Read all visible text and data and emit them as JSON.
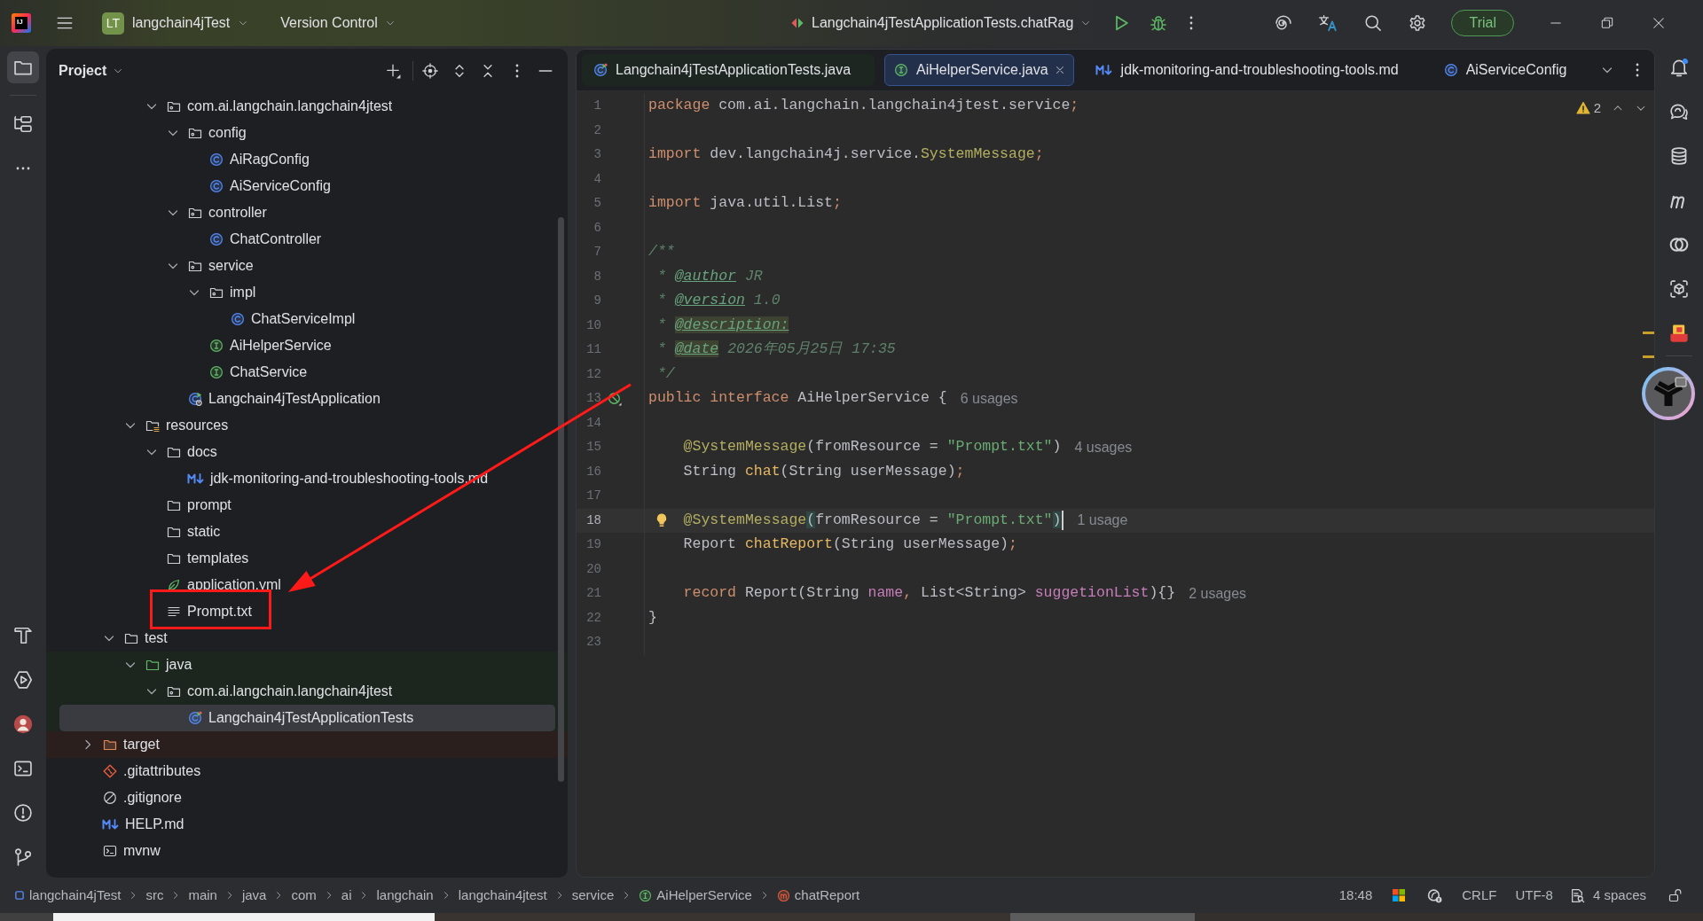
{
  "title_bar": {
    "logo": "IJ",
    "project_badge": "LT",
    "project": "langchain4jTest",
    "vcs": "Version Control",
    "run_config": "Langchain4jTestApplicationTests.chatRag",
    "trial": "Trial"
  },
  "left_tools": {
    "top": [
      {
        "selected": true
      },
      {
        "selected": false
      }
    ],
    "bottom": [
      {
        "selected": false
      },
      {
        "selected": false
      },
      {
        "selected": false
      },
      {
        "selected": false
      },
      {
        "selected": false
      },
      {
        "selected": false
      }
    ]
  },
  "project_panel": {
    "title": "Project",
    "tree": [
      {
        "children": [
          {
            "children": [
              {
                "children": [
                  {
                    "children": [
                      {
                        "label": "com.ai.langchain.langchain4jtest",
                        "kind": "package",
                        "expanded": true,
                        "selected": false,
                        "boxed": false,
                        "children": [
                          {
                            "label": "config",
                            "kind": "package",
                            "expanded": true,
                            "selected": false,
                            "boxed": false,
                            "children": [
                              {
                                "label": "AiRagConfig",
                                "kind": "class",
                                "selected": false,
                                "boxed": false
                              },
                              {
                                "label": "AiServiceConfig",
                                "kind": "class",
                                "selected": false,
                                "boxed": false
                              }
                            ]
                          },
                          {
                            "label": "controller",
                            "kind": "package",
                            "expanded": true,
                            "selected": false,
                            "boxed": false,
                            "children": [
                              {
                                "label": "ChatController",
                                "kind": "class",
                                "selected": false,
                                "boxed": false
                              }
                            ]
                          },
                          {
                            "label": "service",
                            "kind": "package",
                            "expanded": true,
                            "selected": false,
                            "boxed": false,
                            "children": [
                              {
                                "label": "impl",
                                "kind": "package",
                                "expanded": true,
                                "selected": false,
                                "boxed": false,
                                "children": [
                                  {
                                    "label": "ChatServiceImpl",
                                    "kind": "class",
                                    "selected": false,
                                    "boxed": false
                                  }
                                ]
                              },
                              {
                                "label": "AiHelperService",
                                "kind": "interface",
                                "selected": false,
                                "boxed": false
                              },
                              {
                                "label": "ChatService",
                                "kind": "interface",
                                "selected": false,
                                "boxed": false
                              }
                            ]
                          },
                          {
                            "label": "Langchain4jTestApplication",
                            "kind": "app_class",
                            "selected": false,
                            "boxed": false
                          }
                        ]
                      }
                    ]
                  },
                  {
                    "label": "resources",
                    "kind": "resource_root",
                    "expanded": true,
                    "selected": false,
                    "boxed": false,
                    "children": [
                      {
                        "label": "docs",
                        "kind": "folder",
                        "expanded": true,
                        "selected": false,
                        "boxed": false,
                        "children": [
                          {
                            "label": "jdk-monitoring-and-troubleshooting-tools.md",
                            "kind": "markdown",
                            "selected": false,
                            "boxed": false
                          }
                        ]
                      },
                      {
                        "label": "prompt",
                        "kind": "folder",
                        "selected": false,
                        "boxed": false
                      },
                      {
                        "label": "static",
                        "kind": "folder",
                        "selected": false,
                        "boxed": false
                      },
                      {
                        "label": "templates",
                        "kind": "folder",
                        "selected": false,
                        "boxed": false
                      },
                      {
                        "label": "application.yml",
                        "kind": "yaml",
                        "selected": false,
                        "boxed": false
                      },
                      {
                        "label": "Prompt.txt",
                        "kind": "text",
                        "selected": false,
                        "boxed": true
                      }
                    ]
                  }
                ]
              },
              {
                "label": "test",
                "kind": "folder",
                "expanded": true,
                "selected": false,
                "boxed": false,
                "children": [
                  {
                    "label": "java",
                    "kind": "test_root",
                    "expanded": true,
                    "selected": false,
                    "boxed": false,
                    "children": [
                      {
                        "label": "com.ai.langchain.langchain4jtest",
                        "kind": "package",
                        "expanded": true,
                        "selected": false,
                        "boxed": false,
                        "children": [
                          {
                            "label": "Langchain4jTestApplicationTests",
                            "kind": "test_class",
                            "selected": true,
                            "boxed": false
                          }
                        ]
                      }
                    ]
                  }
                ]
              }
            ]
          },
          {
            "label": "target",
            "kind": "excluded",
            "expanded": false,
            "selected": false,
            "boxed": false
          },
          {
            "label": ".gitattributes",
            "kind": "gitattributes",
            "selected": false,
            "boxed": false
          },
          {
            "label": ".gitignore",
            "kind": "gitignore",
            "selected": false,
            "boxed": false
          },
          {
            "label": "HELP.md",
            "kind": "markdown",
            "selected": false,
            "boxed": false
          },
          {
            "label": "mvnw",
            "kind": "script",
            "selected": false,
            "boxed": false
          }
        ]
      }
    ]
  },
  "annotation": {
    "kind": "arrow"
  },
  "editor": {
    "tabs": [
      {
        "label": "Langchain4jTestApplicationTests.java",
        "kind": "test_class",
        "selected": false
      },
      {
        "label": "AiHelperService.java",
        "kind": "interface",
        "selected": true
      },
      {
        "label": "jdk-monitoring-and-troubleshooting-tools.md",
        "kind": "markdown",
        "selected": false
      },
      {
        "label": "AiServiceConfig",
        "kind": "class",
        "selected": false
      }
    ],
    "warnings": "2",
    "lines": [
      {
        "number": "1",
        "current": false,
        "tokens": [
          {
            "text": "package",
            "kind": "keyword"
          },
          {
            "text": " com.ai.langchain.langchain4jtest.service",
            "kind": "plain"
          },
          {
            "text": ";",
            "kind": "punct"
          }
        ]
      },
      {
        "number": "2",
        "current": false
      },
      {
        "number": "3",
        "current": false,
        "tokens": [
          {
            "text": "import",
            "kind": "keyword"
          },
          {
            "text": " dev.langchain4j.service.",
            "kind": "plain"
          },
          {
            "text": "SystemMessage",
            "kind": "annotation"
          },
          {
            "text": ";",
            "kind": "punct"
          }
        ]
      },
      {
        "number": "4",
        "current": false
      },
      {
        "number": "5",
        "current": false,
        "tokens": [
          {
            "text": "import",
            "kind": "keyword"
          },
          {
            "text": " java.util.List",
            "kind": "plain"
          },
          {
            "text": ";",
            "kind": "punct"
          }
        ]
      },
      {
        "number": "6",
        "current": false
      },
      {
        "number": "7",
        "current": false,
        "tokens": [
          {
            "text": "/**",
            "kind": "doc"
          }
        ]
      },
      {
        "number": "8",
        "current": false,
        "tokens": [
          {
            "text": " * ",
            "kind": "doc"
          },
          {
            "text": "@author",
            "kind": "doc_tag"
          },
          {
            "text": " JR",
            "kind": "doc"
          }
        ]
      },
      {
        "number": "9",
        "current": false,
        "tokens": [
          {
            "text": " * ",
            "kind": "doc"
          },
          {
            "text": "@version",
            "kind": "doc_tag"
          },
          {
            "text": " 1.0",
            "kind": "doc"
          }
        ]
      },
      {
        "number": "10",
        "current": false,
        "tokens": [
          {
            "text": " * ",
            "kind": "doc"
          },
          {
            "text": "@description:",
            "kind": "doc_tag_warn"
          }
        ]
      },
      {
        "number": "11",
        "current": false,
        "tokens": [
          {
            "text": " * ",
            "kind": "doc"
          },
          {
            "text": "@date",
            "kind": "doc_tag_warn"
          },
          {
            "text": " 2026年05月25日 17:35",
            "kind": "doc"
          }
        ]
      },
      {
        "number": "12",
        "current": false,
        "tokens": [
          {
            "text": " */",
            "kind": "doc"
          }
        ]
      },
      {
        "number": "13",
        "current": false,
        "marker": {
          "kind": "implemented"
        },
        "hint": "6 usages",
        "tokens": [
          {
            "text": "public interface",
            "kind": "keyword"
          },
          {
            "text": " AiHelperService {",
            "kind": "plain"
          }
        ]
      },
      {
        "number": "14",
        "current": false
      },
      {
        "number": "15",
        "current": false,
        "hint": "4 usages",
        "tokens": [
          {
            "text": "    @SystemMessage",
            "kind": "annotation"
          },
          {
            "text": "(fromResource = ",
            "kind": "plain"
          },
          {
            "text": "\"Prompt.txt\"",
            "kind": "string"
          },
          {
            "text": ")",
            "kind": "plain"
          }
        ]
      },
      {
        "number": "16",
        "current": false,
        "tokens": [
          {
            "text": "    String ",
            "kind": "plain"
          },
          {
            "text": "chat",
            "kind": "method"
          },
          {
            "text": "(String userMessage)",
            "kind": "plain"
          },
          {
            "text": ";",
            "kind": "punct"
          }
        ]
      },
      {
        "number": "17",
        "current": false
      },
      {
        "number": "18",
        "current": true,
        "marker": {
          "kind": "bulb"
        },
        "hint": "1 usage",
        "tokens": [
          {
            "text": "    @SystemMessage",
            "kind": "annotation"
          },
          {
            "text": "(",
            "kind": "brace"
          },
          {
            "text": "fromResource = ",
            "kind": "plain"
          },
          {
            "text": "\"Prompt.txt\"",
            "kind": "string"
          },
          {
            "text": ")",
            "kind": "brace"
          }
        ]
      },
      {
        "number": "19",
        "current": false,
        "tokens": [
          {
            "text": "    Report ",
            "kind": "plain"
          },
          {
            "text": "chatReport",
            "kind": "method"
          },
          {
            "text": "(String userMessage)",
            "kind": "plain"
          },
          {
            "text": ";",
            "kind": "punct"
          }
        ]
      },
      {
        "number": "20",
        "current": false
      },
      {
        "number": "21",
        "current": false,
        "hint": "2 usages",
        "tokens": [
          {
            "text": "    record",
            "kind": "keyword"
          },
          {
            "text": " Report(String ",
            "kind": "plain"
          },
          {
            "text": "name",
            "kind": "field"
          },
          {
            "text": ",",
            "kind": "punct"
          },
          {
            "text": " List<String> ",
            "kind": "plain"
          },
          {
            "text": "suggetionList",
            "kind": "field"
          },
          {
            "text": "){}",
            "kind": "plain"
          }
        ]
      },
      {
        "number": "22",
        "current": false,
        "tokens": [
          {
            "text": "}",
            "kind": "plain"
          }
        ]
      },
      {
        "number": "23",
        "current": false
      }
    ]
  },
  "right_tools": [
    {
      "selected": false
    },
    {
      "selected": false
    },
    {
      "selected": false
    },
    {
      "selected": false
    },
    {
      "selected": false
    },
    {
      "selected": false
    },
    {
      "selected": false
    }
  ],
  "breadcrumbs": [
    {
      "label": "langchain4jTest",
      "kind": "module"
    },
    {
      "label": "src",
      "kind": "plain"
    },
    {
      "label": "main",
      "kind": "plain"
    },
    {
      "label": "java",
      "kind": "plain"
    },
    {
      "label": "com",
      "kind": "plain"
    },
    {
      "label": "ai",
      "kind": "plain"
    },
    {
      "label": "langchain",
      "kind": "plain"
    },
    {
      "label": "langchain4jtest",
      "kind": "plain"
    },
    {
      "label": "service",
      "kind": "plain"
    },
    {
      "label": "AiHelperService",
      "kind": "interface"
    },
    {
      "label": "chatReport",
      "kind": "method"
    }
  ],
  "status_bar": {
    "position": "18:48",
    "line_separator": "CRLF",
    "encoding": "UTF-8",
    "indent": "4 spaces"
  }
}
